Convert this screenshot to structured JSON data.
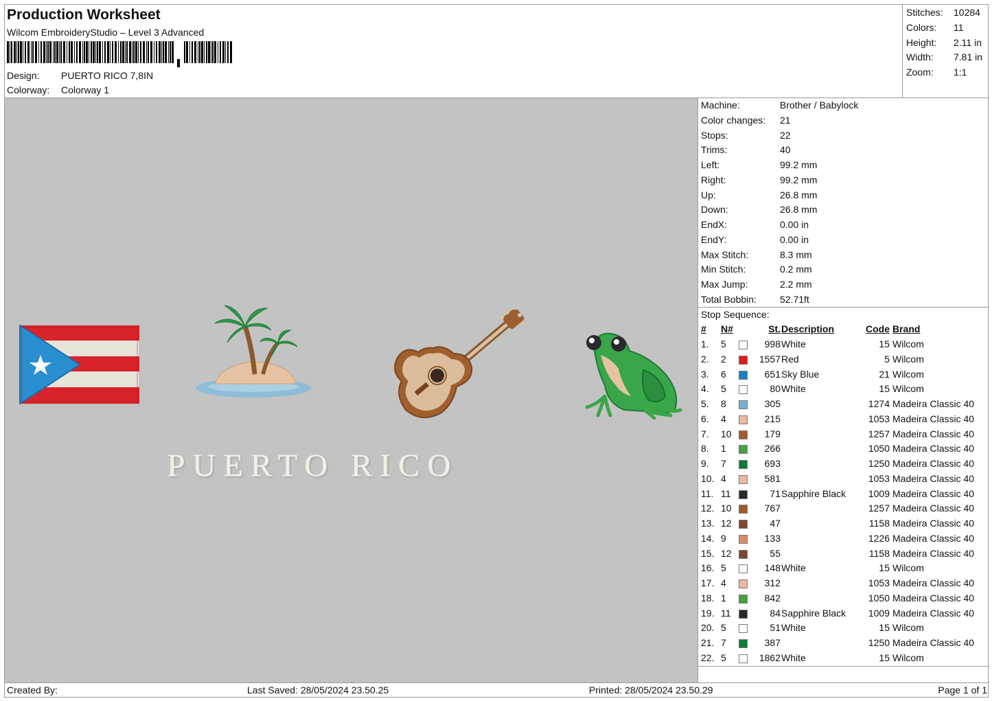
{
  "header": {
    "title": "Production Worksheet",
    "software": "Wilcom EmbroideryStudio – Level 3 Advanced",
    "design_label": "Design:",
    "design_value": "PUERTO RICO 7,8IN",
    "colorway_label": "Colorway:",
    "colorway_value": "Colorway 1"
  },
  "stats": [
    {
      "label": "Stitches:",
      "value": "10284"
    },
    {
      "label": "Colors:",
      "value": "11"
    },
    {
      "label": "Height:",
      "value": "2.11 in"
    },
    {
      "label": "Width:",
      "value": "7.81 in"
    },
    {
      "label": "Zoom:",
      "value": "1:1"
    }
  ],
  "design": {
    "text": "PUERTO RICO",
    "motifs": [
      "flag-icon",
      "palm-island-icon",
      "guitar-icon",
      "coqui-frog-icon"
    ]
  },
  "machine": [
    {
      "label": "Machine:",
      "value": "Brother / Babylock"
    },
    {
      "label": "Color changes:",
      "value": "21"
    },
    {
      "label": "Stops:",
      "value": "22"
    },
    {
      "label": "Trims:",
      "value": "40"
    },
    {
      "label": "Left:",
      "value": "99.2 mm"
    },
    {
      "label": "Right:",
      "value": "99.2 mm"
    },
    {
      "label": "Up:",
      "value": "26.8 mm"
    },
    {
      "label": "Down:",
      "value": "26.8 mm"
    },
    {
      "label": "EndX:",
      "value": "0.00 in"
    },
    {
      "label": "EndY:",
      "value": "0.00 in"
    },
    {
      "label": "Max Stitch:",
      "value": "8.3 mm"
    },
    {
      "label": "Min Stitch:",
      "value": "0.2 mm"
    },
    {
      "label": "Max Jump:",
      "value": "2.2 mm"
    },
    {
      "label": "Total Bobbin:",
      "value": "52.71ft"
    }
  ],
  "stop_sequence": {
    "title": "Stop Sequence:",
    "headers": {
      "idx": "#",
      "n": "N#",
      "st": "St.",
      "desc": "Description",
      "code": "Code",
      "brand": "Brand"
    },
    "rows": [
      {
        "idx": "1.",
        "n": "5",
        "color": "#ffffff",
        "st": "998",
        "desc": "White",
        "code": "15",
        "brand": "Wilcom"
      },
      {
        "idx": "2.",
        "n": "2",
        "color": "#e01b1b",
        "st": "1557",
        "desc": "Red",
        "code": "5",
        "brand": "Wilcom"
      },
      {
        "idx": "3.",
        "n": "6",
        "color": "#1a7fc4",
        "st": "651",
        "desc": "Sky Blue",
        "code": "21",
        "brand": "Wilcom"
      },
      {
        "idx": "4.",
        "n": "5",
        "color": "#ffffff",
        "st": "80",
        "desc": "White",
        "code": "15",
        "brand": "Wilcom"
      },
      {
        "idx": "5.",
        "n": "8",
        "color": "#7aaed3",
        "st": "305",
        "desc": "",
        "code": "1274",
        "brand": "Madeira Classic 40"
      },
      {
        "idx": "6.",
        "n": "4",
        "color": "#e9b8a4",
        "st": "215",
        "desc": "",
        "code": "1053",
        "brand": "Madeira Classic 40"
      },
      {
        "idx": "7.",
        "n": "10",
        "color": "#a25a2e",
        "st": "179",
        "desc": "",
        "code": "1257",
        "brand": "Madeira Classic 40"
      },
      {
        "idx": "8.",
        "n": "1",
        "color": "#4aa043",
        "st": "266",
        "desc": "",
        "code": "1050",
        "brand": "Madeira Classic 40"
      },
      {
        "idx": "9.",
        "n": "7",
        "color": "#0f7a3c",
        "st": "693",
        "desc": "",
        "code": "1250",
        "brand": "Madeira Classic 40"
      },
      {
        "idx": "10.",
        "n": "4",
        "color": "#e9b8a4",
        "st": "581",
        "desc": "",
        "code": "1053",
        "brand": "Madeira Classic 40"
      },
      {
        "idx": "11.",
        "n": "11",
        "color": "#2a2a2e",
        "st": "71",
        "desc": "Sapphire Black",
        "code": "1009",
        "brand": "Madeira Classic 40"
      },
      {
        "idx": "12.",
        "n": "10",
        "color": "#a25a2e",
        "st": "767",
        "desc": "",
        "code": "1257",
        "brand": "Madeira Classic 40"
      },
      {
        "idx": "13.",
        "n": "12",
        "color": "#7b4632",
        "st": "47",
        "desc": "",
        "code": "1158",
        "brand": "Madeira Classic 40"
      },
      {
        "idx": "14.",
        "n": "9",
        "color": "#d88c63",
        "st": "133",
        "desc": "",
        "code": "1226",
        "brand": "Madeira Classic 40"
      },
      {
        "idx": "15.",
        "n": "12",
        "color": "#7b4632",
        "st": "55",
        "desc": "",
        "code": "1158",
        "brand": "Madeira Classic 40"
      },
      {
        "idx": "16.",
        "n": "5",
        "color": "#ffffff",
        "st": "148",
        "desc": "White",
        "code": "15",
        "brand": "Wilcom"
      },
      {
        "idx": "17.",
        "n": "4",
        "color": "#e9b8a4",
        "st": "312",
        "desc": "",
        "code": "1053",
        "brand": "Madeira Classic 40"
      },
      {
        "idx": "18.",
        "n": "1",
        "color": "#4aa043",
        "st": "842",
        "desc": "",
        "code": "1050",
        "brand": "Madeira Classic 40"
      },
      {
        "idx": "19.",
        "n": "11",
        "color": "#2a2a2e",
        "st": "84",
        "desc": "Sapphire Black",
        "code": "1009",
        "brand": "Madeira Classic 40"
      },
      {
        "idx": "20.",
        "n": "5",
        "color": "#ffffff",
        "st": "51",
        "desc": "White",
        "code": "15",
        "brand": "Wilcom"
      },
      {
        "idx": "21.",
        "n": "7",
        "color": "#0f7a3c",
        "st": "387",
        "desc": "",
        "code": "1250",
        "brand": "Madeira Classic 40"
      },
      {
        "idx": "22.",
        "n": "5",
        "color": "#ffffff",
        "st": "1862",
        "desc": "White",
        "code": "15",
        "brand": "Wilcom"
      }
    ]
  },
  "footer": {
    "created_by": "Created By:",
    "last_saved": "Last Saved: 28/05/2024 23.50.25",
    "printed": "Printed: 28/05/2024 23.50.29",
    "page": "Page 1 of 1"
  }
}
